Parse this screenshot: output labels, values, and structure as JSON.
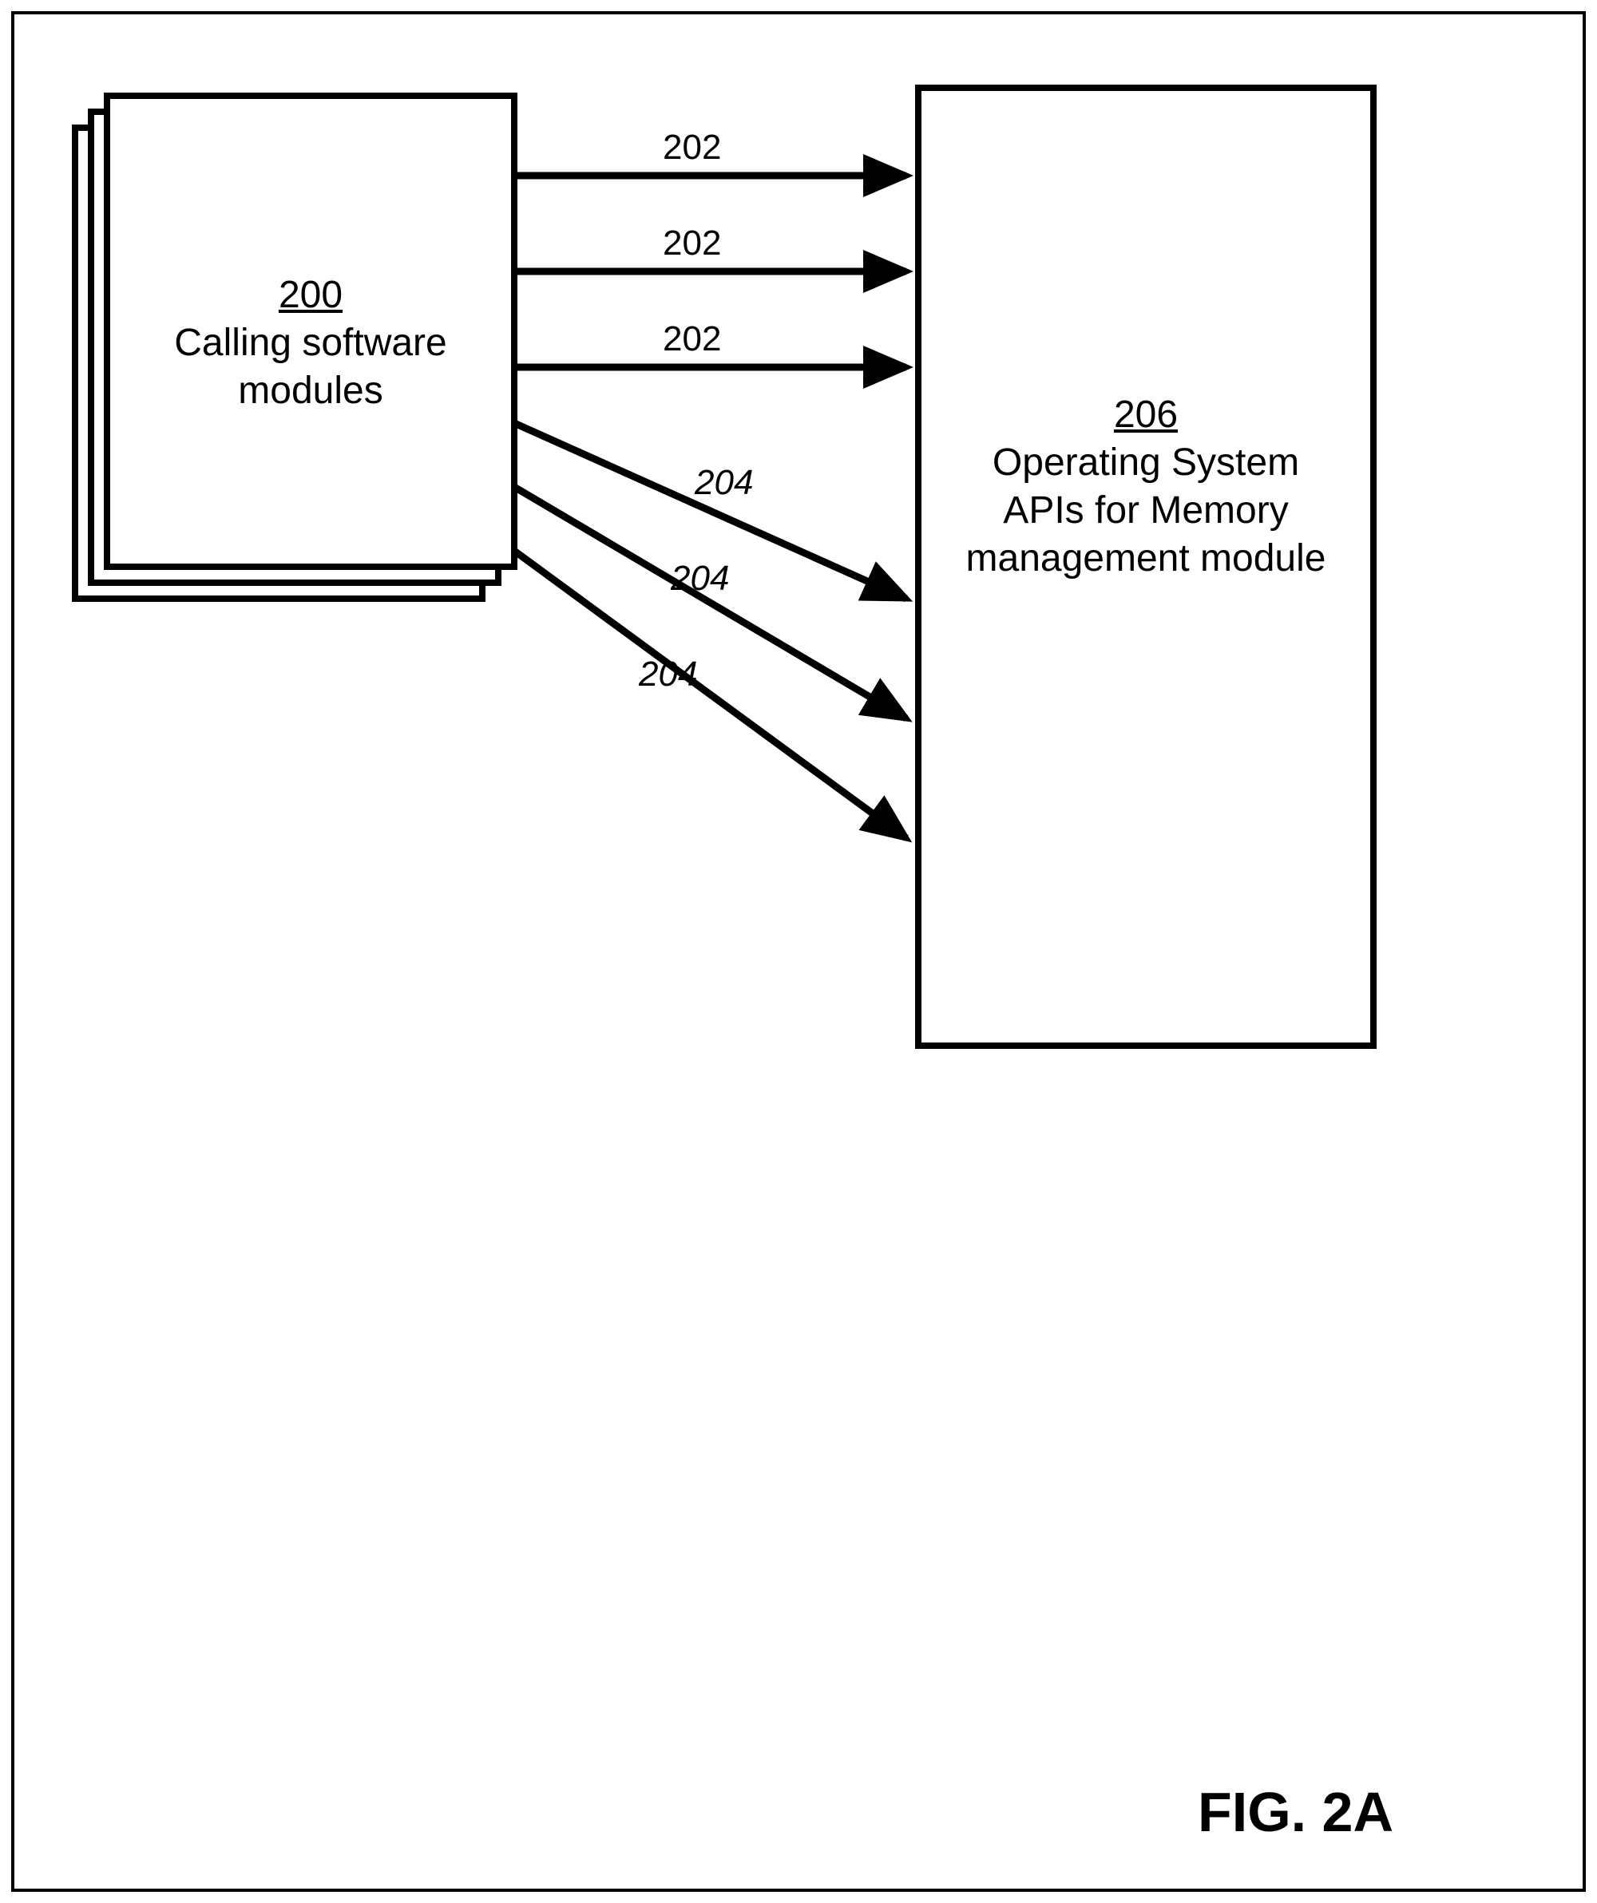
{
  "left_box": {
    "ref": "200",
    "label_line1": "Calling software",
    "label_line2": "modules"
  },
  "right_box": {
    "ref": "206",
    "label_line1": "Operating System",
    "label_line2": "APIs for Memory",
    "label_line3": "management module"
  },
  "arrows": {
    "top_group": [
      "202",
      "202",
      "202"
    ],
    "bottom_group": [
      "204",
      "204",
      "204"
    ]
  },
  "figure_label": "FIG. 2A"
}
